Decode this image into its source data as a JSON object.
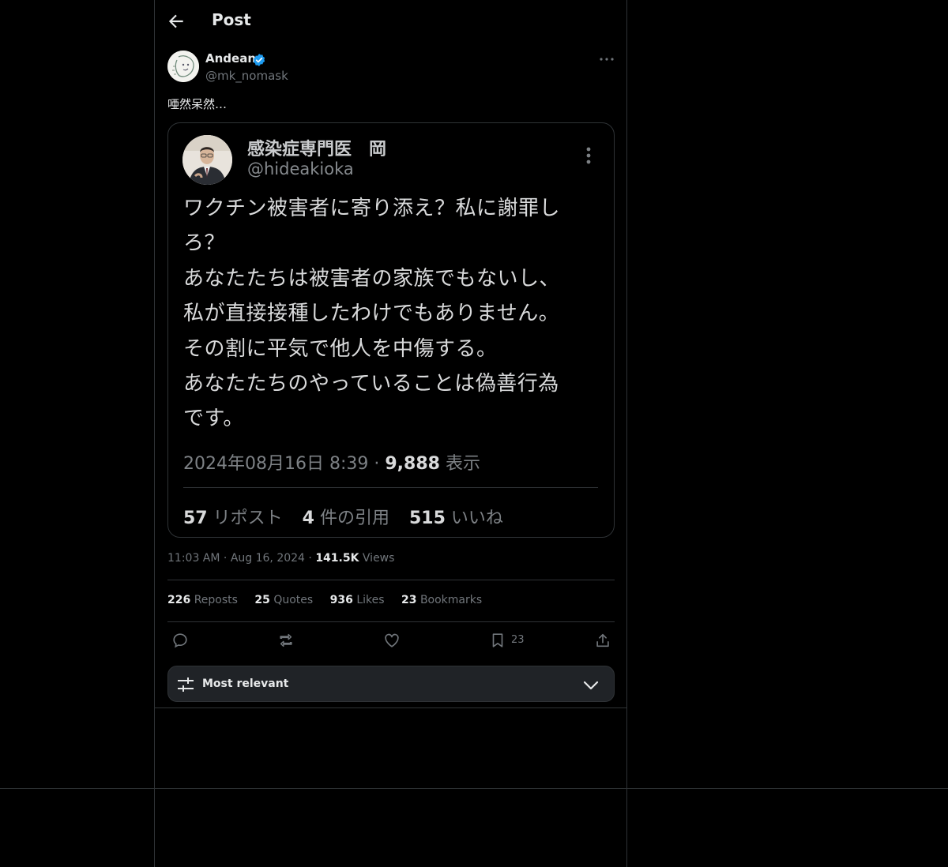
{
  "header": {
    "title": "Post"
  },
  "post": {
    "author_name": "Andean",
    "author_handle": "@mk_nomask",
    "text": "唖然呆然…"
  },
  "quoted": {
    "name": "感染症専門医　岡",
    "handle": "@hideakioka",
    "body_lines": [
      "ワクチン被害者に寄り添え？私に謝罪し",
      "ろ？",
      "あなたたちは被害者の家族でもないし、",
      "私が直接接種したわけでもありません。",
      "その割に平気で他人を中傷する。",
      "あなたたちのやっていることは偽善行為",
      "です。"
    ],
    "datetime": "2024年08月16日 8:39",
    "separator": "·",
    "views_count": "9,888",
    "views_label": "表示",
    "reposts_count": "57",
    "reposts_label": "リポスト",
    "quotes_count": "4",
    "quotes_label": "件の引用",
    "likes_count": "515",
    "likes_label": "いいね"
  },
  "meta": {
    "time": "11:03 AM",
    "date": "Aug 16, 2024",
    "views_count": "141.5K",
    "views_label": "Views"
  },
  "counts": {
    "reposts_count": "226",
    "reposts_label": "Reposts",
    "quotes_count": "25",
    "quotes_label": "Quotes",
    "likes_count": "936",
    "likes_label": "Likes",
    "bookmarks_count": "23",
    "bookmarks_label": "Bookmarks"
  },
  "actions": {
    "bookmark_count": "23",
    "icons": [
      "reply-icon",
      "repost-icon",
      "like-icon",
      "bookmark-icon",
      "share-icon"
    ]
  },
  "sort": {
    "label": "Most relevant"
  },
  "colors": {
    "verified": "#1d9bf0",
    "background": "#000000",
    "text": "#e7e9ea",
    "muted": "#71767b",
    "border": "#2f3336"
  }
}
